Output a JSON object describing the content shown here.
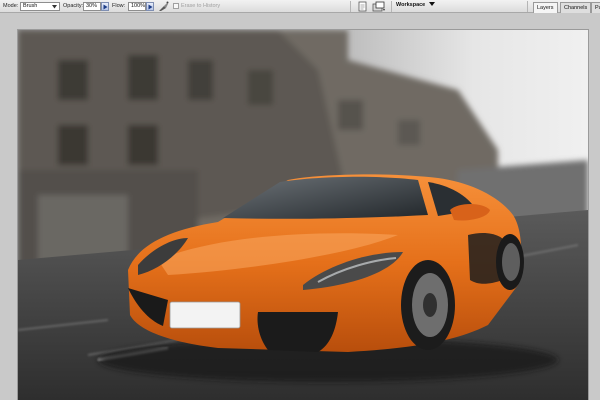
{
  "options_bar": {
    "mode_label": "Mode:",
    "mode_value": "Brush",
    "opacity_label": "Opacity:",
    "opacity_value": "30%",
    "flow_label": "Flow:",
    "flow_value": "100%",
    "erase_to_history_label": "Erase to History",
    "workspace_label": "Workspace"
  },
  "panel_tabs": [
    {
      "label": "Layers"
    },
    {
      "label": "Channels"
    },
    {
      "label": "Pa"
    }
  ],
  "document": {
    "subject": "orange sports car with motion-blurred street",
    "colors": {
      "car": "#e8701c",
      "background": "#6b6b6b",
      "sky": "#d9d9d9"
    }
  }
}
